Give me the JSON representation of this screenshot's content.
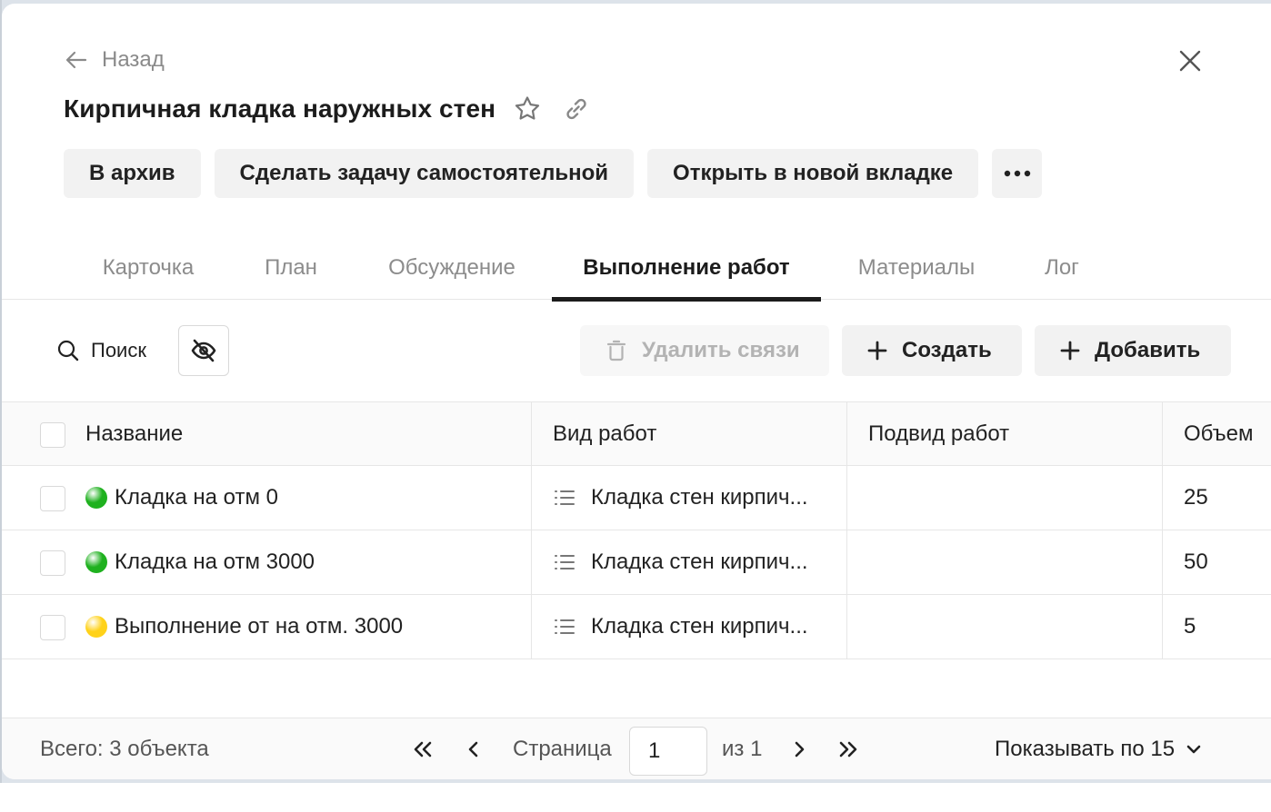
{
  "header": {
    "back_label": "Назад",
    "title": "Кирпичная кладка наружных стен"
  },
  "actions": {
    "archive": "В архив",
    "make_independent": "Сделать задачу самостоятельной",
    "open_new_tab": "Открыть в новой вкладке"
  },
  "tabs": [
    {
      "label": "Карточка",
      "active": false
    },
    {
      "label": "План",
      "active": false
    },
    {
      "label": "Обсуждение",
      "active": false
    },
    {
      "label": "Выполнение работ",
      "active": true
    },
    {
      "label": "Материалы",
      "active": false
    },
    {
      "label": "Лог",
      "active": false
    }
  ],
  "toolbar": {
    "search_label": "Поиск",
    "delete_links": "Удалить связи",
    "create": "Создать",
    "add": "Добавить"
  },
  "table": {
    "columns": [
      "Название",
      "Вид работ",
      "Подвид работ",
      "Объем"
    ],
    "rows": [
      {
        "status_color": "#1fb11f",
        "name": "Кладка на отм 0",
        "work_type": "Кладка стен кирпич...",
        "subtype": "",
        "volume": "25"
      },
      {
        "status_color": "#1fb11f",
        "name": "Кладка на отм 3000",
        "work_type": "Кладка стен кирпич...",
        "subtype": "",
        "volume": "50"
      },
      {
        "status_color": "#ffd21a",
        "name": "Выполнение от на отм. 3000",
        "work_type": "Кладка стен кирпич...",
        "subtype": "",
        "volume": "5"
      }
    ]
  },
  "footer": {
    "total": "Всего: 3 объекта",
    "page_label": "Страница",
    "page_value": "1",
    "of_label": "из 1",
    "per_page": "Показывать по 15"
  }
}
